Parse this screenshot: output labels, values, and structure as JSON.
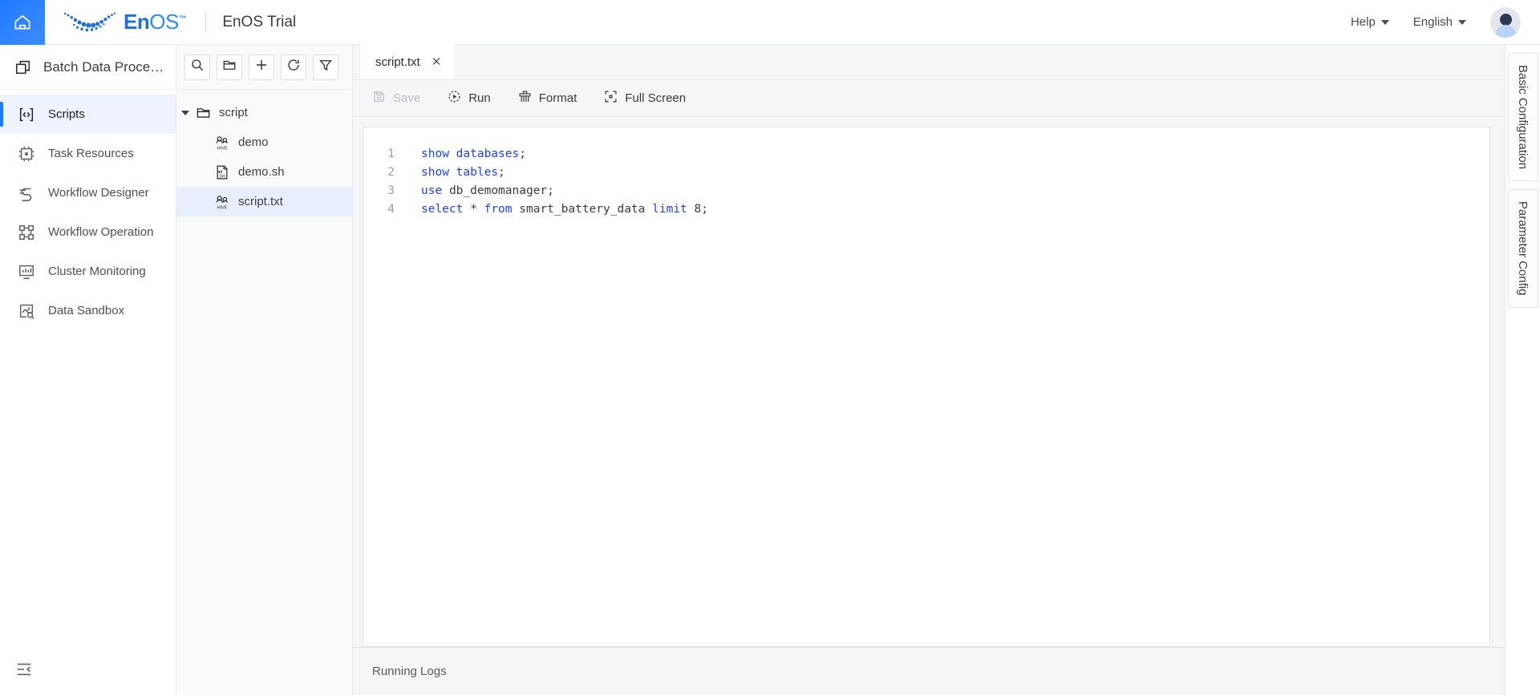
{
  "header": {
    "home_icon": "home-icon",
    "brand_en": "En",
    "brand_os": "OS",
    "brand_tm": "™",
    "app_title": "EnOS Trial",
    "help_label": "Help",
    "language_label": "English",
    "avatar": "user-avatar"
  },
  "sidebar": {
    "title": "Batch Data Proce…",
    "title_icon": "stacked-squares-icon",
    "collapse_icon": "collapse-panel-icon",
    "items": [
      {
        "label": "Scripts",
        "icon": "code-brackets-icon",
        "active": true
      },
      {
        "label": "Task Resources",
        "icon": "chip-icon",
        "active": false
      },
      {
        "label": "Workflow Designer",
        "icon": "flow-nodes-icon",
        "active": false
      },
      {
        "label": "Workflow Operation",
        "icon": "workflow-graph-icon",
        "active": false
      },
      {
        "label": "Cluster Monitoring",
        "icon": "monitor-chart-icon",
        "active": false
      },
      {
        "label": "Data Sandbox",
        "icon": "data-sandbox-icon",
        "active": false
      }
    ]
  },
  "tree_panel": {
    "toolbar": [
      {
        "name": "search-icon",
        "title": "Search"
      },
      {
        "name": "folder-icon",
        "title": "New Folder"
      },
      {
        "name": "plus-icon",
        "title": "New"
      },
      {
        "name": "refresh-icon",
        "title": "Refresh"
      },
      {
        "name": "filter-icon",
        "title": "Filter"
      }
    ],
    "root": {
      "label": "script",
      "icon": "folder-icon",
      "expanded": true
    },
    "children": [
      {
        "label": "demo",
        "icon": "hive-file-icon",
        "selected": false
      },
      {
        "label": "demo.sh",
        "icon": "sh-file-icon",
        "selected": false
      },
      {
        "label": "script.txt",
        "icon": "hive-file-icon",
        "selected": true
      }
    ]
  },
  "editor": {
    "tab_label": "script.txt",
    "tab_close": "✕",
    "toolbar": [
      {
        "label": "Save",
        "icon": "save-icon",
        "disabled": true
      },
      {
        "label": "Run",
        "icon": "run-icon",
        "disabled": false
      },
      {
        "label": "Format",
        "icon": "format-icon",
        "disabled": false
      },
      {
        "label": "Full Screen",
        "icon": "fullscreen-icon",
        "disabled": false
      }
    ],
    "line_numbers": [
      "1",
      "2",
      "3",
      "4"
    ],
    "lines": [
      [
        {
          "t": "show",
          "c": "kw"
        },
        {
          "t": " ",
          "c": "op"
        },
        {
          "t": "databases",
          "c": "kw"
        },
        {
          "t": ";",
          "c": "op"
        }
      ],
      [
        {
          "t": "show",
          "c": "kw"
        },
        {
          "t": " ",
          "c": "op"
        },
        {
          "t": "tables",
          "c": "kw"
        },
        {
          "t": ";",
          "c": "op"
        }
      ],
      [
        {
          "t": "use",
          "c": "kw"
        },
        {
          "t": " ",
          "c": "op"
        },
        {
          "t": "db_demomanager",
          "c": "id"
        },
        {
          "t": ";",
          "c": "op"
        }
      ],
      [
        {
          "t": "select",
          "c": "kw"
        },
        {
          "t": " * ",
          "c": "op"
        },
        {
          "t": "from",
          "c": "kw"
        },
        {
          "t": " ",
          "c": "op"
        },
        {
          "t": "smart_battery_data",
          "c": "id"
        },
        {
          "t": " ",
          "c": "op"
        },
        {
          "t": "limit",
          "c": "kw"
        },
        {
          "t": " ",
          "c": "op"
        },
        {
          "t": "8",
          "c": "num"
        },
        {
          "t": ";",
          "c": "op"
        }
      ]
    ],
    "code_plain": "show databases;\nshow tables;\nuse db_demomanager;\nselect * from smart_battery_data limit 8;"
  },
  "logs": {
    "title": "Running Logs"
  },
  "right_rail": {
    "tabs": [
      {
        "label": "Basic Configuration"
      },
      {
        "label": "Parameter Config"
      }
    ]
  },
  "colors": {
    "accent": "#1f7bff",
    "keyword": "#1a41ff",
    "selection": "#e8effc",
    "panel_bg": "#f5f6f8"
  }
}
